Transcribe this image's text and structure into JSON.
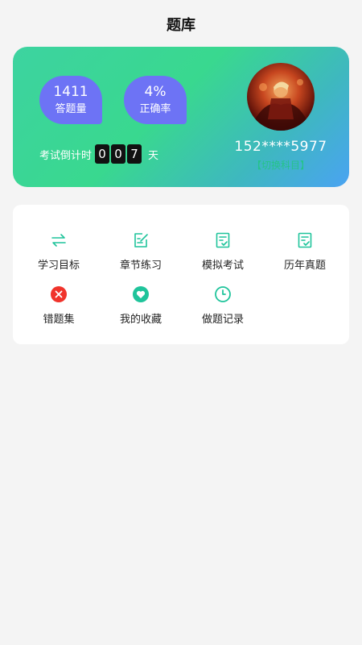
{
  "header": {
    "title": "题库"
  },
  "stats": {
    "answered": {
      "value": "1411",
      "label": "答题量"
    },
    "accuracy": {
      "value": "4%",
      "label": "正确率"
    }
  },
  "countdown": {
    "label": "考试倒计时",
    "digits": [
      "0",
      "0",
      "7"
    ],
    "unit": "天"
  },
  "user": {
    "phone": "152****5977",
    "switch_label": "【切换科目】"
  },
  "menu": {
    "items": [
      {
        "label": "学习目标",
        "icon": "repeat-arrows-icon"
      },
      {
        "label": "章节练习",
        "icon": "edit-note-icon"
      },
      {
        "label": "模拟考试",
        "icon": "checklist-icon"
      },
      {
        "label": "历年真题",
        "icon": "checklist-icon"
      },
      {
        "label": "错题集",
        "icon": "wrong-x-icon"
      },
      {
        "label": "我的收藏",
        "icon": "heart-icon"
      },
      {
        "label": "做题记录",
        "icon": "clock-icon"
      }
    ]
  },
  "colors": {
    "accent": "#1fc49b",
    "stat_bubble": "#6d73f5",
    "error_red": "#f0332b",
    "background": "#f4f4f4"
  }
}
